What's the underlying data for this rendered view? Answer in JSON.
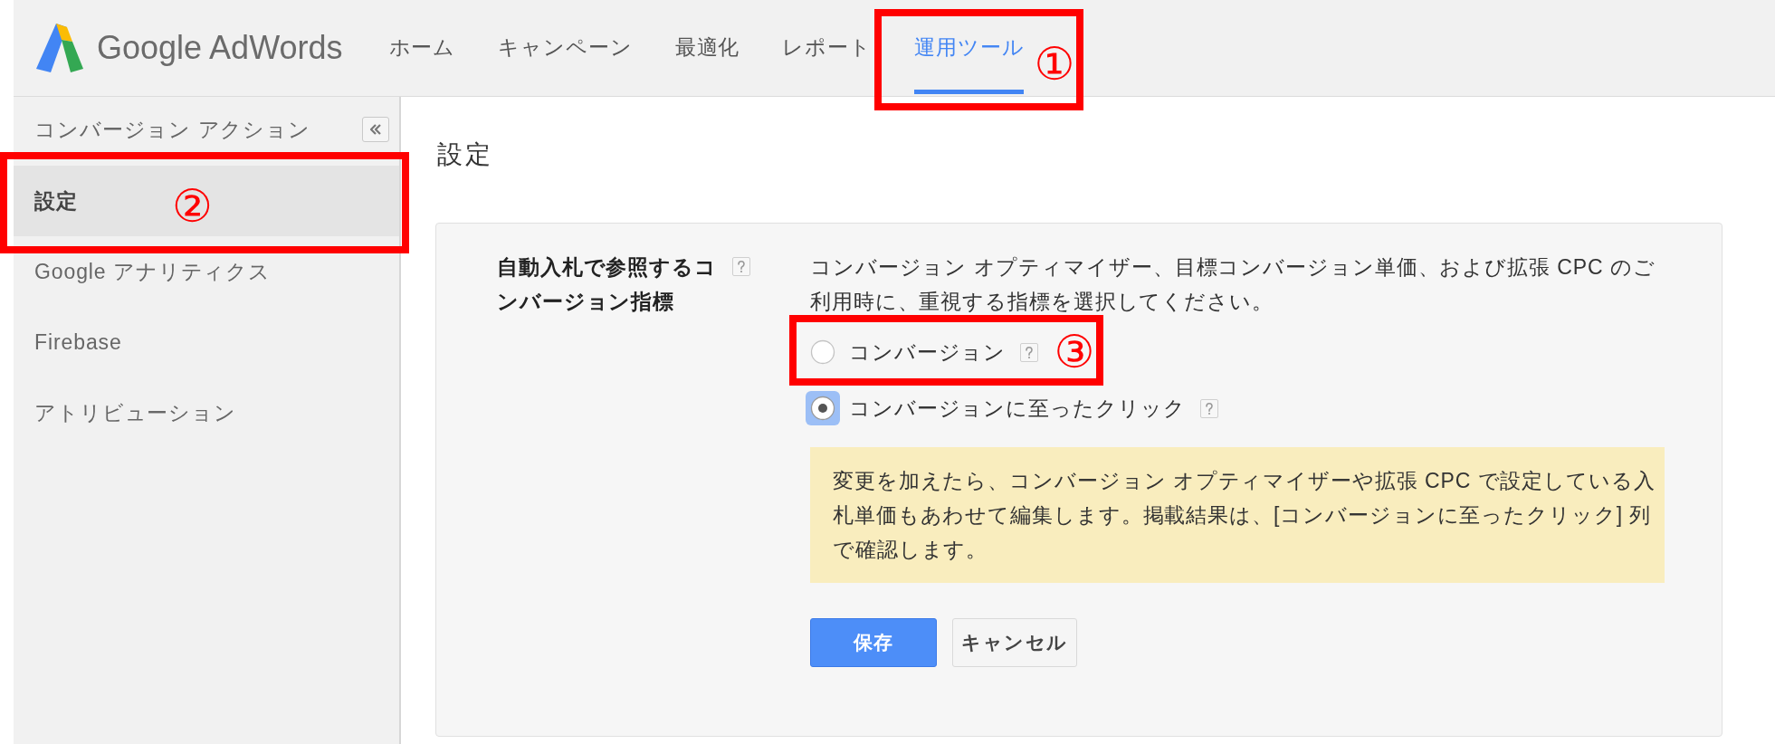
{
  "header": {
    "logo_text": "Google AdWords",
    "nav": [
      {
        "label": "ホーム",
        "selected": false
      },
      {
        "label": "キャンペーン",
        "selected": false
      },
      {
        "label": "最適化",
        "selected": false
      },
      {
        "label": "レポート",
        "selected": false
      },
      {
        "label": "運用ツール",
        "selected": true,
        "annotation": "①"
      }
    ]
  },
  "sidebar": {
    "title": "コンバージョン アクション",
    "items": [
      {
        "label": "設定",
        "selected": true,
        "annotation": "②"
      },
      {
        "label": "Google アナリティクス",
        "selected": false
      },
      {
        "label": "Firebase",
        "selected": false
      },
      {
        "label": "アトリビューション",
        "selected": false
      }
    ]
  },
  "main": {
    "heading": "設定",
    "setting": {
      "label": "自動入札で参照するコンバージョン指標",
      "help": true,
      "description": "コンバージョン オプティマイザー、目標コンバージョン単価、および拡張 CPC のご利用時に、重視する指標を選択してください。",
      "options": [
        {
          "label": "コンバージョン",
          "selected": false,
          "help": true,
          "annotation": "③"
        },
        {
          "label": "コンバージョンに至ったクリック",
          "selected": true,
          "help": true
        }
      ],
      "notice": "変更を加えたら、コンバージョン オプティマイザーや拡張 CPC で設定している入札単価もあわせて編集します。掲載結果は、[コンバージョンに至ったクリック] 列で確認します。",
      "buttons": [
        {
          "label": "保存",
          "kind": "primary"
        },
        {
          "label": "キャンセル",
          "kind": "secondary"
        }
      ]
    }
  }
}
